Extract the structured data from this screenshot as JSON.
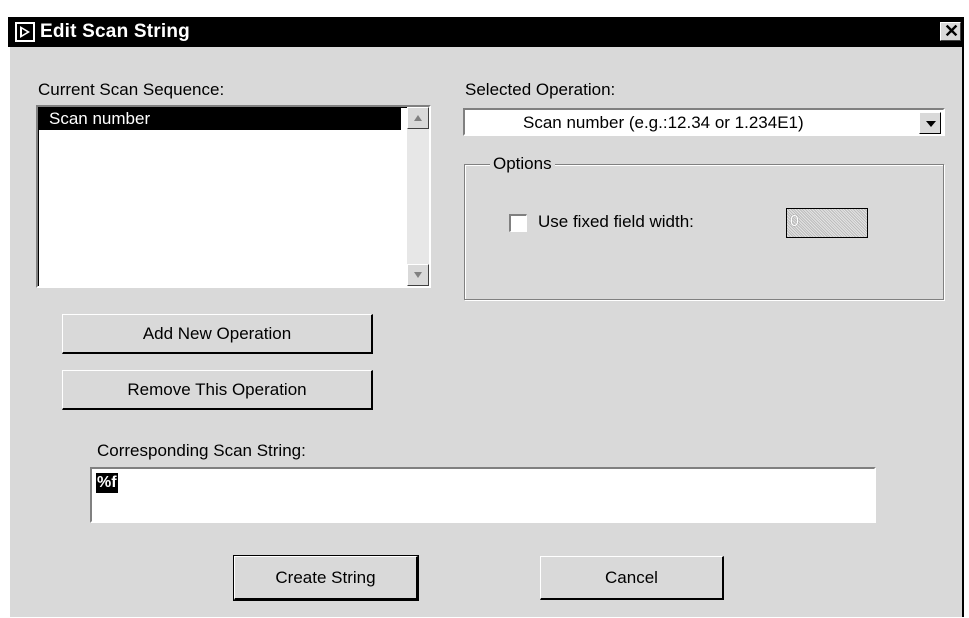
{
  "window": {
    "title": "Edit Scan String",
    "close_glyph": "✕"
  },
  "sequence": {
    "label": "Current Scan Sequence:",
    "items": [
      "Scan number"
    ]
  },
  "operation": {
    "label": "Selected Operation:",
    "selected": "Scan number   (e.g.:12.34 or 1.234E1)"
  },
  "options": {
    "legend": "Options",
    "fixed_width_label": "Use fixed field width:",
    "fixed_width_checked": false,
    "width_value": "0"
  },
  "buttons": {
    "add": "Add New Operation",
    "remove": "Remove This Operation",
    "create": "Create String",
    "cancel": "Cancel"
  },
  "scan_string": {
    "label": "Corresponding Scan String:",
    "value": "%f"
  },
  "icons": {
    "app": "run-arrow-icon",
    "scroll_up": "scroll-up-arrow-icon",
    "scroll_down": "scroll-down-arrow-icon",
    "dropdown": "dropdown-arrow-icon"
  }
}
